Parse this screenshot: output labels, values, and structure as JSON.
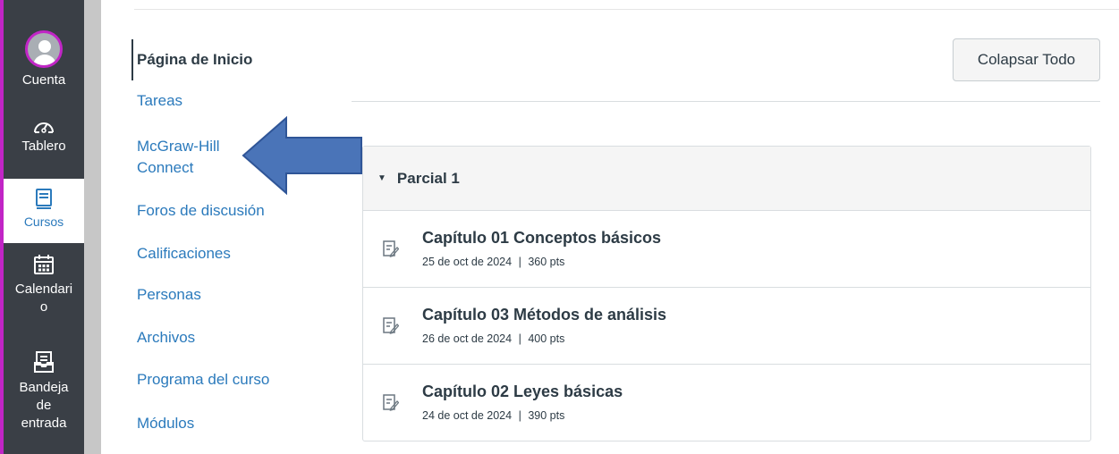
{
  "global_nav": {
    "items": [
      {
        "label": "Cuenta",
        "icon": "avatar-icon"
      },
      {
        "label": "Tablero",
        "icon": "dashboard-icon"
      },
      {
        "label": "Cursos",
        "icon": "courses-icon"
      },
      {
        "label": "Calendari\no",
        "icon": "calendar-icon"
      },
      {
        "label": "Bandeja\nde\nentrada",
        "icon": "inbox-icon"
      }
    ],
    "active": "Cursos",
    "accent_color": "#c125c6",
    "background_color": "#3a3f46"
  },
  "course_nav": {
    "items": [
      {
        "label": "Página de Inicio"
      },
      {
        "label": "Tareas"
      },
      {
        "label": "McGraw-Hill\nConnect"
      },
      {
        "label": "Foros de discusión"
      },
      {
        "label": "Calificaciones"
      },
      {
        "label": "Personas"
      },
      {
        "label": "Archivos"
      },
      {
        "label": "Programa del curso"
      },
      {
        "label": "Módulos"
      }
    ],
    "active": "Página de Inicio",
    "link_color": "#2b7abc"
  },
  "toolbar": {
    "collapse_all_label": "Colapsar Todo"
  },
  "module": {
    "title": "Parcial 1",
    "items": [
      {
        "title": "Capítulo 01 Conceptos básicos",
        "date": "25 de oct de 2024",
        "points": "360 pts"
      },
      {
        "title": "Capítulo 03 Métodos de análisis",
        "date": "26 de oct de 2024",
        "points": "400 pts"
      },
      {
        "title": "Capítulo 02 Leyes básicas",
        "date": "24 de oct de 2024",
        "points": "390 pts"
      }
    ],
    "meta_separator": "|"
  },
  "annotation": {
    "arrow_color": "#4a74b8",
    "arrow_target": "McGraw-Hill Connect"
  }
}
